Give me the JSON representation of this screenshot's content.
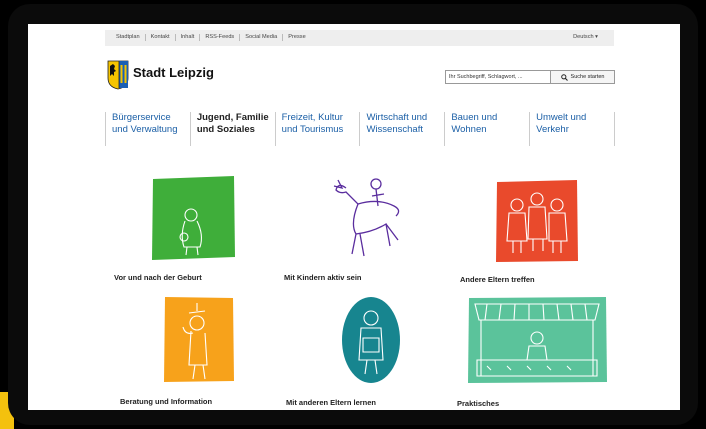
{
  "topbar": {
    "links": [
      "Stadtplan",
      "Kontakt",
      "Inhalt",
      "RSS-Feeds",
      "Social Media",
      "Presse"
    ],
    "language": "Deutsch ▾"
  },
  "site": {
    "name": "Stadt Leipzig"
  },
  "search": {
    "placeholder": "Ihr Suchbegriff, Schlagwort, ...",
    "button_label": "Suche starten"
  },
  "nav": {
    "items": [
      {
        "line1": "Bürgerservice",
        "line2": "und Verwaltung"
      },
      {
        "line1": "Jugend, Familie",
        "line2": "und Soziales"
      },
      {
        "line1": "Freizeit, Kultur",
        "line2": "und Tourismus"
      },
      {
        "line1": "Wirtschaft und",
        "line2": "Wissenschaft"
      },
      {
        "line1": "Bauen und",
        "line2": "Wohnen"
      },
      {
        "line1": "Umwelt und",
        "line2": "Verkehr"
      }
    ]
  },
  "tiles": [
    {
      "label": "Vor und nach der Geburt",
      "color": "#3fae3a"
    },
    {
      "label": "Mit Kindern aktiv sein",
      "color": "#ffffff"
    },
    {
      "label": "Andere Eltern treffen",
      "color": "#e94a2c"
    },
    {
      "label": "Beratung und Information",
      "color": "#f7a21b"
    },
    {
      "label": "Mit anderen Eltern lernen",
      "color": "#17858f"
    },
    {
      "label": "Praktisches",
      "color": "#5bc39b"
    }
  ]
}
